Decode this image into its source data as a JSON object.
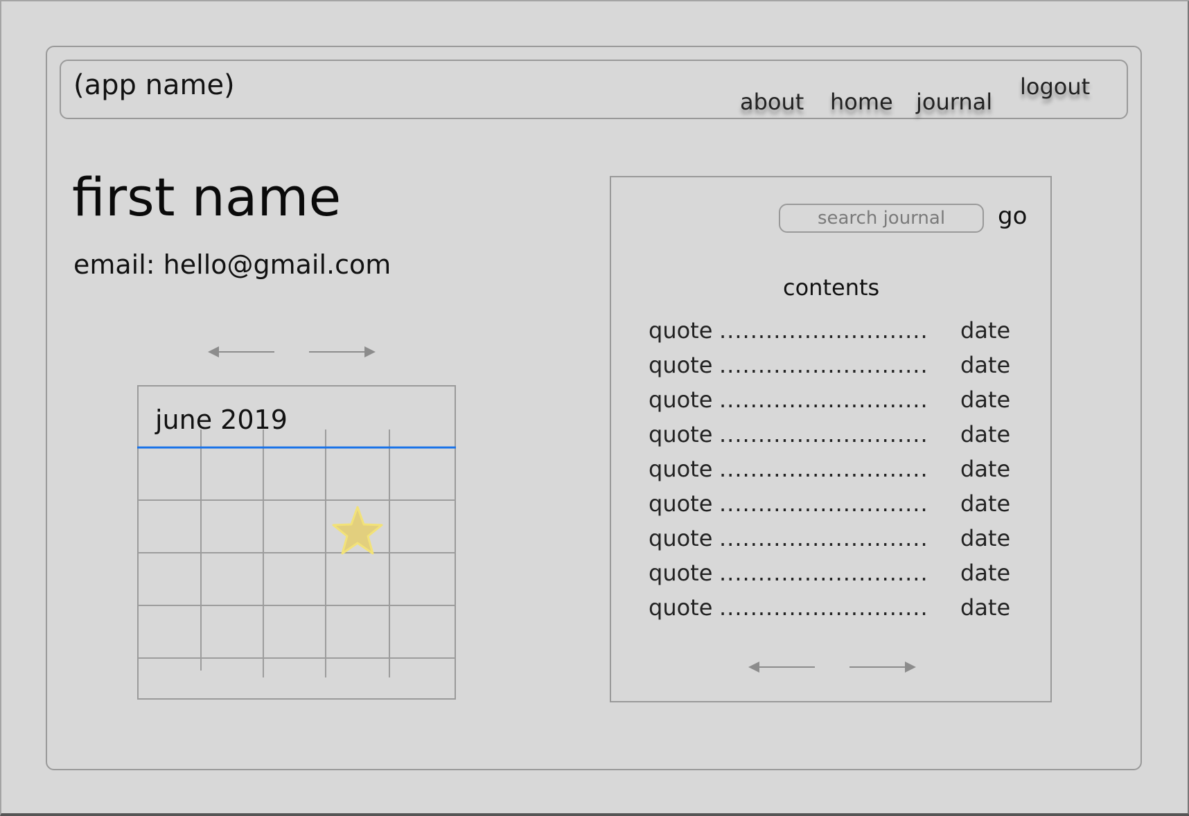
{
  "header": {
    "app_name": "(app name)",
    "nav": {
      "about": "about",
      "home": "home",
      "journal": "journal",
      "logout": "logout"
    }
  },
  "profile": {
    "name": "first name",
    "email": "email: hello@gmail.com"
  },
  "calendar": {
    "month_label": "june 2019",
    "accent_color": "#1a73e8",
    "star_color": "#e8d070"
  },
  "journal": {
    "search_placeholder": "search journal",
    "go_label": "go",
    "contents_heading": "contents",
    "entries": [
      {
        "quote": "quote",
        "leader": "...........................",
        "date": "date"
      },
      {
        "quote": "quote",
        "leader": "...........................",
        "date": "date"
      },
      {
        "quote": "quote",
        "leader": "...........................",
        "date": "date"
      },
      {
        "quote": "quote",
        "leader": "...........................",
        "date": "date"
      },
      {
        "quote": "quote",
        "leader": "...........................",
        "date": "date"
      },
      {
        "quote": "quote",
        "leader": "...........................",
        "date": "date"
      },
      {
        "quote": "quote",
        "leader": "...........................",
        "date": "date"
      },
      {
        "quote": "quote",
        "leader": "...........................",
        "date": "date"
      },
      {
        "quote": "quote",
        "leader": "...........................",
        "date": "date"
      }
    ]
  }
}
